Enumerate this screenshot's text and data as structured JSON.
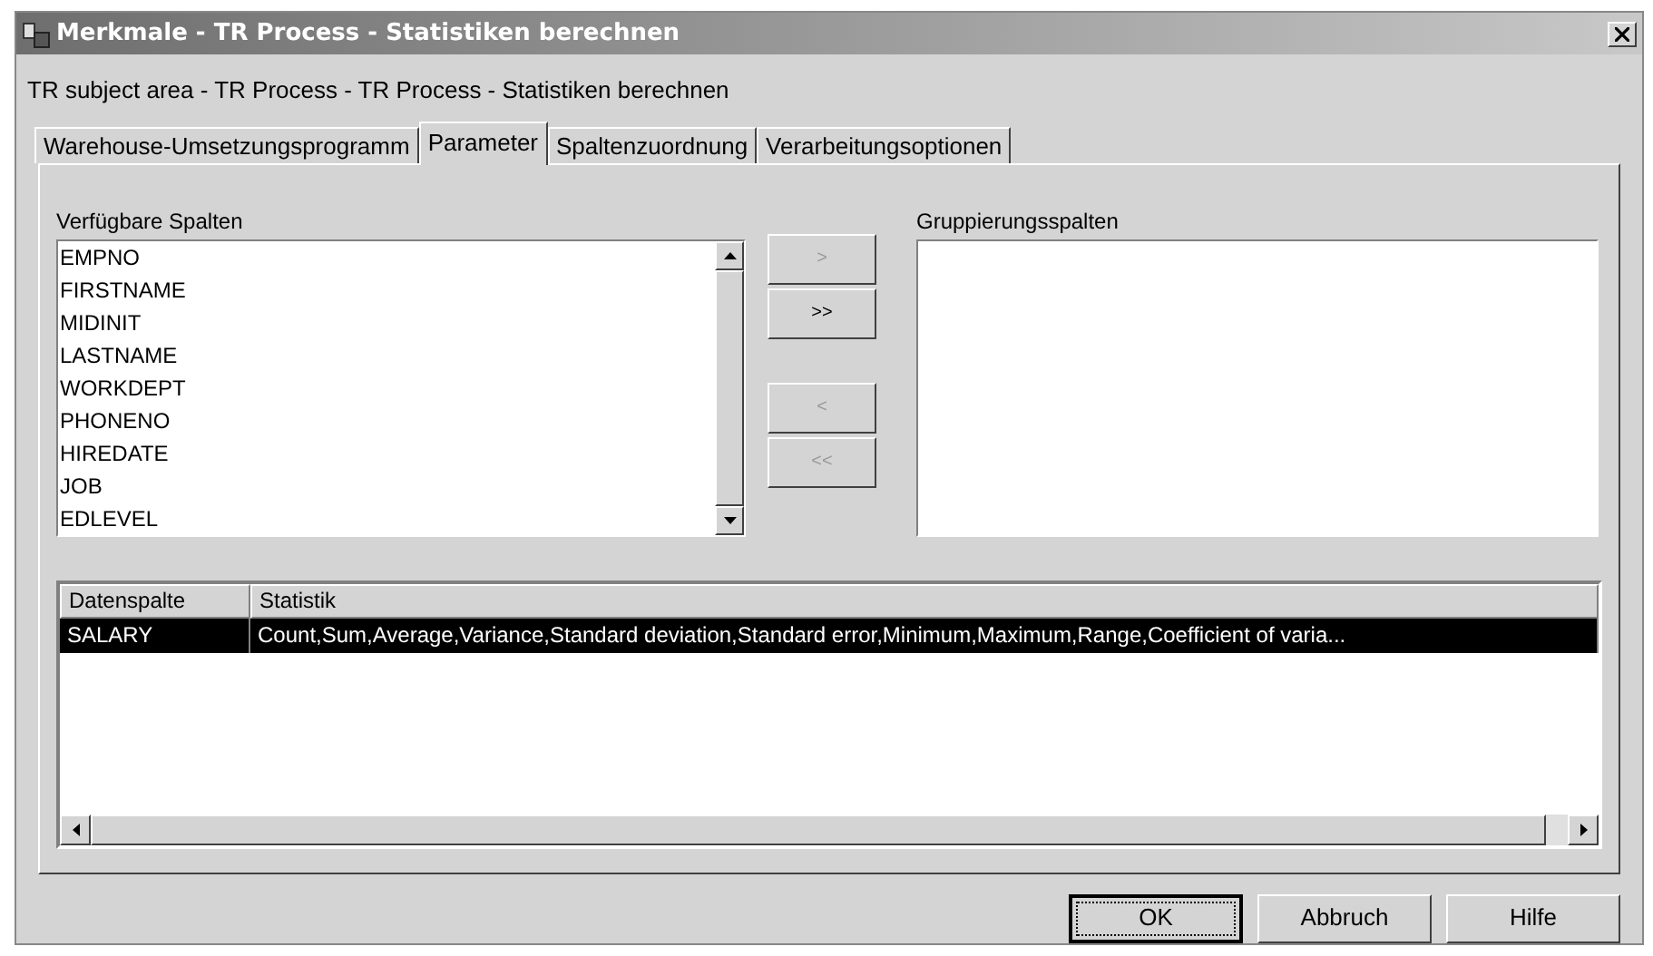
{
  "window": {
    "title": "Merkmale - TR Process - Statistiken berechnen"
  },
  "subtitle": "TR subject area - TR Process - TR Process - Statistiken berechnen",
  "tabs": [
    {
      "label": "Warehouse-Umsetzungsprogramm",
      "selected": false
    },
    {
      "label": "Parameter",
      "selected": true
    },
    {
      "label": "Spaltenzuordnung",
      "selected": false
    },
    {
      "label": "Verarbeitungsoptionen",
      "selected": false
    }
  ],
  "available_columns": {
    "label": "Verfügbare Spalten",
    "items": [
      "EMPNO",
      "FIRSTNAME",
      "MIDINIT",
      "LASTNAME",
      "WORKDEPT",
      "PHONENO",
      "HIREDATE",
      "JOB",
      "EDLEVEL"
    ]
  },
  "move_buttons": [
    {
      "label": ">",
      "disabled": true
    },
    {
      "label": ">>",
      "disabled": false
    },
    {
      "label": "<",
      "disabled": true
    },
    {
      "label": "<<",
      "disabled": true
    }
  ],
  "grouping_columns": {
    "label": "Gruppierungsspalten"
  },
  "table": {
    "columns": [
      "Datenspalte",
      "Statistik"
    ],
    "rows": [
      {
        "cells": [
          "SALARY",
          "Count,Sum,Average,Variance,Standard deviation,Standard error,Minimum,Maximum,Range,Coefficient of varia..."
        ],
        "selected": true
      }
    ]
  },
  "buttons": [
    {
      "label": "OK",
      "focused": true
    },
    {
      "label": "Abbruch",
      "focused": false
    },
    {
      "label": "Hilfe",
      "focused": false
    }
  ]
}
